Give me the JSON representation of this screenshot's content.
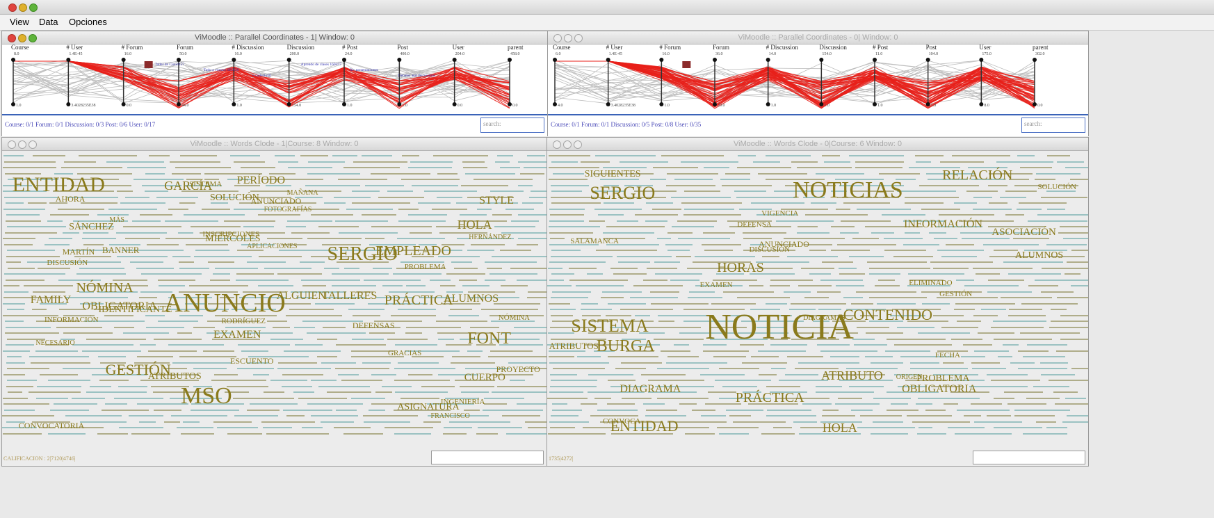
{
  "menu": {
    "view": "View",
    "data": "Data",
    "opciones": "Opciones"
  },
  "pc1": {
    "title": "ViMoodle :: Parallel Coordinates - 1| Window: 0",
    "axes": [
      {
        "name": "Course",
        "max": "8.0",
        "min": "1.0"
      },
      {
        "name": "# User",
        "max": "1.4E-45",
        "min": "3.4028235E38"
      },
      {
        "name": "# Forum",
        "max": "16.0",
        "min": "0.0"
      },
      {
        "name": "Forum",
        "max": "50.0",
        "min": "44.0"
      },
      {
        "name": "# Discussion",
        "max": "16.0",
        "min": "1.0"
      },
      {
        "name": "Discussion",
        "max": "200.0",
        "min": "154.0"
      },
      {
        "name": "# Post",
        "max": "24.0",
        "min": "1.0"
      },
      {
        "name": "Post",
        "max": "400.0",
        "min": "1.0"
      },
      {
        "name": "User",
        "max": "204.0",
        "min": "0.0"
      },
      {
        "name": "parent",
        "max": "458.0",
        "min": "0.0"
      }
    ],
    "labels": [
      "Taller de Cloud157",
      "Todo a vuestro SEIS58",
      "v·callecio56",
      "Aprendo de clases 160157",
      "Re: presentaciones",
      "Debates and discussions"
    ],
    "status": "Course: 0/1 Forum: 0/1 Discussion: 0/3 Post: 0/6 User: 0/17",
    "search_placeholder": "search:"
  },
  "pc0": {
    "title": "ViMoodle :: Parallel Coordinates - 0| Window: 0",
    "axes": [
      {
        "name": "Course",
        "max": "6.0",
        "min": "4.0"
      },
      {
        "name": "# User",
        "max": "1.4E-45",
        "min": "3.4028235E38"
      },
      {
        "name": "# Forum",
        "max": "16.0",
        "min": "1.0"
      },
      {
        "name": "Forum",
        "max": "36.0",
        "min": "20.0"
      },
      {
        "name": "# Discussion",
        "max": "14.0",
        "min": "1.0"
      },
      {
        "name": "Discussion",
        "max": "154.0",
        "min": "1.0"
      },
      {
        "name": "# Post",
        "max": "11.0",
        "min": "1.0"
      },
      {
        "name": "Post",
        "max": "104.0",
        "min": "1.0"
      },
      {
        "name": "User",
        "max": "175.0",
        "min": "8.0"
      },
      {
        "name": "parent",
        "max": "302.0",
        "min": "0.0"
      }
    ],
    "status": "Course: 0/1 Forum: 0/1 Discussion: 0/5 Post: 0/8 User: 0/35",
    "search_placeholder": "search:"
  },
  "wc1": {
    "title": "ViMoodle :: Words Clode - 1|Course: 8 Window: 0",
    "footer": "CALIFICACION : 2|7120|4746|",
    "words": [
      {
        "t": "ANUNCIO",
        "s": 38
      },
      {
        "t": "ALGUIEN",
        "s": 16
      },
      {
        "t": "ALUMNOS",
        "s": 16
      },
      {
        "t": "APLICACIONES",
        "s": 10
      },
      {
        "t": "ATRIBUTOS",
        "s": 14
      },
      {
        "t": "BANNER",
        "s": 13
      },
      {
        "t": "ASIGNATURA",
        "s": 14
      },
      {
        "t": "CONVOCATORIA",
        "s": 12
      },
      {
        "t": "CUERPO",
        "s": 15
      },
      {
        "t": "DEFENSAS",
        "s": 12
      },
      {
        "t": "DISCUSIÓN",
        "s": 11
      },
      {
        "t": "INSCRIPCIONES",
        "s": 11
      },
      {
        "t": "ESCUENTO",
        "s": 12
      },
      {
        "t": "EMPLEADO",
        "s": 20
      },
      {
        "t": "ENTIDAD",
        "s": 30
      },
      {
        "t": "EXAMEN",
        "s": 16
      },
      {
        "t": "ANUNCIADO",
        "s": 12
      },
      {
        "t": "FAMILY",
        "s": 16
      },
      {
        "t": "FONT",
        "s": 24
      },
      {
        "t": "FOTOGRAFÍAS",
        "s": 10
      },
      {
        "t": "FRANCISCO",
        "s": 10
      },
      {
        "t": "GARCÍA",
        "s": 18
      },
      {
        "t": "GESTIÓN",
        "s": 22
      },
      {
        "t": "GRACIAS",
        "s": 11
      },
      {
        "t": "HERNÁNDEZ",
        "s": 10
      },
      {
        "t": "HOLA",
        "s": 18
      },
      {
        "t": "AHORA",
        "s": 12
      },
      {
        "t": "INFORMACIÓN",
        "s": 11
      },
      {
        "t": "INGENIERÍA",
        "s": 11
      },
      {
        "t": "IDENTIFICANTE",
        "s": 14
      },
      {
        "t": "MARTÍN",
        "s": 12
      },
      {
        "t": "MAÑANA",
        "s": 10
      },
      {
        "t": "MIÉRCOLES",
        "s": 14
      },
      {
        "t": "MSO",
        "s": 34
      },
      {
        "t": "MÁS",
        "s": 10
      },
      {
        "t": "NECESARIO",
        "s": 10
      },
      {
        "t": "NÓMINA",
        "s": 20
      },
      {
        "t": "OBLIGATORIA",
        "s": 16
      },
      {
        "t": "PERÍODO",
        "s": 16
      },
      {
        "t": "PRÁCTICA",
        "s": 20
      },
      {
        "t": "PROBLEMA",
        "s": 11
      },
      {
        "t": "PROYECTO",
        "s": 12
      },
      {
        "t": "SERGIO",
        "s": 28
      },
      {
        "t": "SOLUCIÓN",
        "s": 14
      },
      {
        "t": "STYLE",
        "s": 16
      },
      {
        "t": "SÁNCHEZ",
        "s": 14
      },
      {
        "t": "SISTEMA",
        "s": 11
      },
      {
        "t": "TALLERES",
        "s": 16
      },
      {
        "t": "RODRÍGUEZ",
        "s": 11
      },
      {
        "t": "NÓMINA",
        "s": 11
      }
    ]
  },
  "wc0": {
    "title": "ViMoodle :: Words Clode - 0|Course: 6 Window: 0",
    "footer": "1735|4272|",
    "words": [
      {
        "t": "ALUMNOS",
        "s": 14
      },
      {
        "t": "ASOCIACIÓN",
        "s": 15
      },
      {
        "t": "ATRIBUTO",
        "s": 18
      },
      {
        "t": "ATRIBUTOS",
        "s": 13
      },
      {
        "t": "CONTENIDO",
        "s": 22
      },
      {
        "t": "CONVOCA",
        "s": 11
      },
      {
        "t": "DEFENSA",
        "s": 11
      },
      {
        "t": "DIAGRAMA",
        "s": 16
      },
      {
        "t": "DIAGRAMAS",
        "s": 10
      },
      {
        "t": "DISCUSIÓN",
        "s": 11
      },
      {
        "t": "ELIMINADO",
        "s": 11
      },
      {
        "t": "ENTIDAD",
        "s": 22
      },
      {
        "t": "ANUNCIADO",
        "s": 12
      },
      {
        "t": "FECHA",
        "s": 11
      },
      {
        "t": "EXAMEN",
        "s": 11
      },
      {
        "t": "GESTIÓN",
        "s": 11
      },
      {
        "t": "HOLA",
        "s": 18
      },
      {
        "t": "HORAS",
        "s": 20
      },
      {
        "t": "INFORMACIÓN",
        "s": 16
      },
      {
        "t": "NOTICIA",
        "s": 52
      },
      {
        "t": "NOTICIAS",
        "s": 34
      },
      {
        "t": "OBLIGATORIA",
        "s": 16
      },
      {
        "t": "PROBLEMA",
        "s": 14
      },
      {
        "t": "PRÁCTICA",
        "s": 20
      },
      {
        "t": "BURGA",
        "s": 24
      },
      {
        "t": "RELACIÓN",
        "s": 20
      },
      {
        "t": "SERGIO",
        "s": 26
      },
      {
        "t": "SIGUIENTES",
        "s": 14
      },
      {
        "t": "SISTEMA",
        "s": 26
      },
      {
        "t": "SOLUCIÓN",
        "s": 11
      },
      {
        "t": "SALAMANCA",
        "s": 11
      },
      {
        "t": "ORIGEN",
        "s": 10
      },
      {
        "t": "VIGENCIA",
        "s": 11
      }
    ]
  },
  "colors": {
    "accent": "#e8201a",
    "word": "#8a7a1c",
    "status": "#4a4ab8",
    "line": "#5aa0a0"
  }
}
